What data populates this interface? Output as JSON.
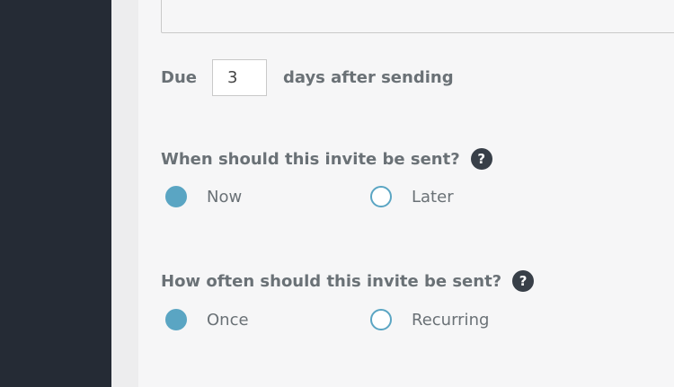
{
  "form": {
    "due_label": "Due",
    "due_days_value": "3",
    "due_suffix": "days after sending",
    "when_question": "When should this invite be sent?",
    "when_options": [
      {
        "label": "Now",
        "checked": true
      },
      {
        "label": "Later",
        "checked": false
      }
    ],
    "often_question": "How often should this invite be sent?",
    "often_options": [
      {
        "label": "Once",
        "checked": true
      },
      {
        "label": "Recurring",
        "checked": false
      }
    ],
    "help_glyph": "?"
  },
  "colors": {
    "sidebar": "#252b35",
    "radio_accent": "#5aa5c3",
    "help_icon_bg": "#383f48"
  }
}
